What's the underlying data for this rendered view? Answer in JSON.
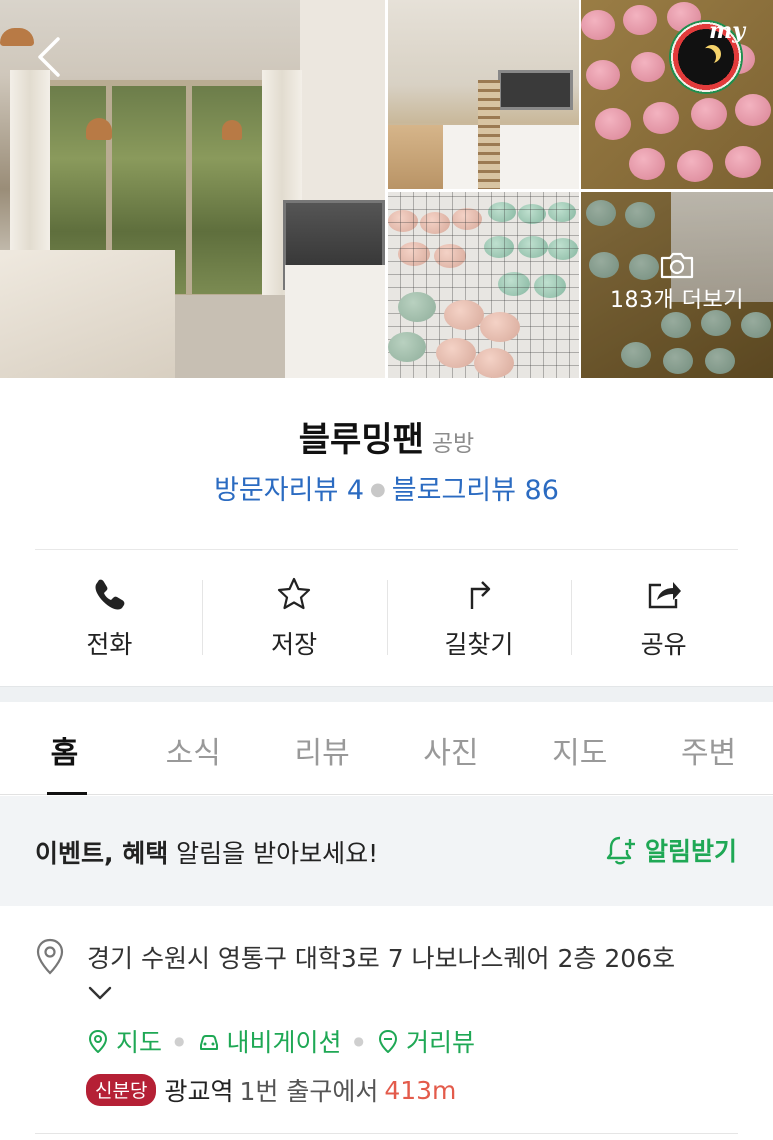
{
  "gallery": {
    "more_photos_label": "183개 더보기",
    "my_badge_label": "my"
  },
  "place": {
    "name": "블루밍팬",
    "category": "공방",
    "visitor_reviews_label": "방문자리뷰 4",
    "blog_reviews_label": "블로그리뷰 86"
  },
  "actions": [
    {
      "label": "전화",
      "icon": "phone-icon"
    },
    {
      "label": "저장",
      "icon": "star-icon"
    },
    {
      "label": "길찾기",
      "icon": "directions-icon"
    },
    {
      "label": "공유",
      "icon": "share-icon"
    }
  ],
  "tabs": [
    {
      "label": "홈",
      "active": true
    },
    {
      "label": "소식",
      "active": false
    },
    {
      "label": "리뷰",
      "active": false
    },
    {
      "label": "사진",
      "active": false
    },
    {
      "label": "지도",
      "active": false
    },
    {
      "label": "주변",
      "active": false
    }
  ],
  "notify": {
    "message_bold": "이벤트, 혜택",
    "message_rest": " 알림을 받아보세요!",
    "button_label": "알림받기"
  },
  "info": {
    "address": "경기 수원시 영통구 대학3로 7 나보나스퀘어 2층 206호",
    "links": [
      {
        "label": "지도",
        "icon": "map-pin-icon"
      },
      {
        "label": "내비게이션",
        "icon": "navigation-car-icon"
      },
      {
        "label": "거리뷰",
        "icon": "street-view-icon"
      }
    ],
    "station": {
      "line": "신분당",
      "name": "광교역",
      "exit_text": "1번 출구에서",
      "distance": "413m"
    }
  },
  "colors": {
    "review_blue": "#2b6bc1",
    "naver_green": "#1fa855",
    "line_badge": "#b52035",
    "distance_red": "#e35b4b"
  }
}
